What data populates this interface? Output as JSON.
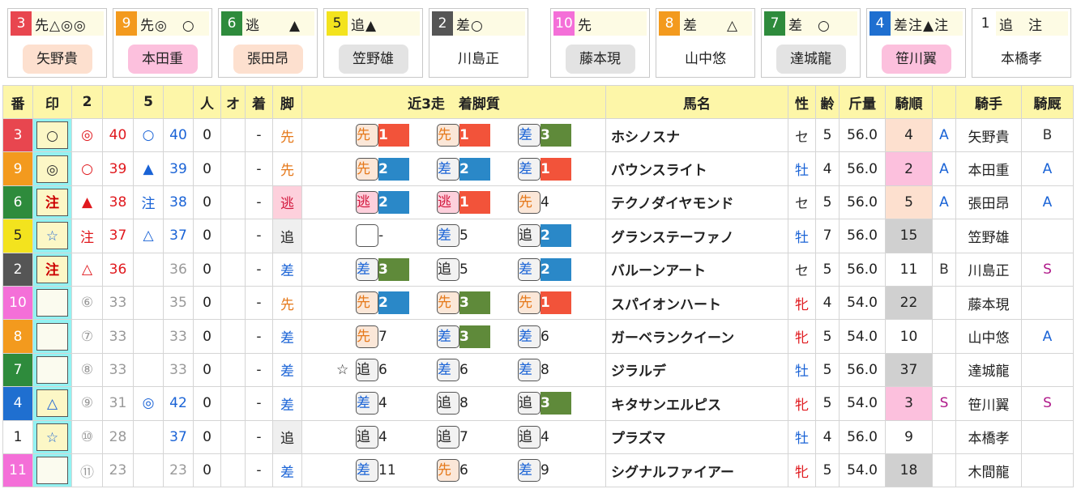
{
  "cards": [
    {
      "num": "3",
      "marks": "先△◎◎",
      "name": "矢野貴",
      "num_color": "#e8464f",
      "name_bg": "#fde0cf"
    },
    {
      "num": "9",
      "marks": "先◎　○",
      "name": "本田重",
      "num_color": "#f39a1e",
      "name_bg": "#fcc0dd"
    },
    {
      "num": "6",
      "marks": "逃　　▲",
      "name": "張田昂",
      "num_color": "#2e8b3c",
      "name_bg": "#fde0cf"
    },
    {
      "num": "5",
      "marks": "追▲",
      "name": "笠野雄",
      "num_color": "#f3e31e",
      "name_bg": "#e3e3e3"
    },
    {
      "num": "2",
      "marks": "差○",
      "name": "川島正",
      "num_color": "#555555",
      "name_bg": "#ffffff"
    },
    {
      "num": "10",
      "marks": "先",
      "name": "藤本現",
      "num_color": "#f46fd8",
      "name_bg": "#e3e3e3"
    },
    {
      "num": "8",
      "marks": "差　　△",
      "name": "山中悠",
      "num_color": "#f39a1e",
      "name_bg": "#ffffff"
    },
    {
      "num": "7",
      "marks": "差　○",
      "name": "達城龍",
      "num_color": "#2e8b3c",
      "name_bg": "#e3e3e3"
    },
    {
      "num": "4",
      "marks": "差注▲注",
      "name": "笹川翼",
      "num_color": "#1f6fd0",
      "name_bg": "#fcc0dd"
    },
    {
      "num": "1",
      "marks": "追　注",
      "name": "本橋孝",
      "num_color": "#ffffff",
      "name_bg": "#ffffff"
    }
  ],
  "headers": [
    "番",
    "印",
    "2",
    "",
    "5",
    "",
    "人",
    "オ",
    "着",
    "脚",
    "近3走　着脚質",
    "馬名",
    "性",
    "齢",
    "斤量",
    "騎順",
    "",
    "騎手",
    "騎厩"
  ],
  "rows": [
    {
      "num": "3",
      "num_color": "#e8464f",
      "mark": "○",
      "m2": "◎",
      "v2": "40",
      "m5": "○",
      "v5": "40",
      "ninki": "0",
      "o": "",
      "chaku": "-",
      "kyaku": "先",
      "runs": [
        {
          "pre": "",
          "leg": "先",
          "rank": "1"
        },
        {
          "pre": "",
          "leg": "先",
          "rank": "1"
        },
        {
          "pre": "",
          "leg": "差",
          "rank": "3"
        }
      ],
      "name": "ホシノスナ",
      "sex": "セ",
      "age": "5",
      "weight": "56.0",
      "jockey_rank": "4",
      "jr_bg": "#fde0cf",
      "grade": "A",
      "jockey": "矢野貴",
      "stable": "B"
    },
    {
      "num": "9",
      "num_color": "#f39a1e",
      "mark": "◎",
      "m2": "○",
      "v2": "39",
      "m5": "▲",
      "v5": "39",
      "ninki": "0",
      "o": "",
      "chaku": "-",
      "kyaku": "先",
      "runs": [
        {
          "pre": "",
          "leg": "先",
          "rank": "2"
        },
        {
          "pre": "",
          "leg": "差",
          "rank": "2"
        },
        {
          "pre": "",
          "leg": "差",
          "rank": "1"
        }
      ],
      "name": "バウンスライト",
      "sex": "牡",
      "age": "4",
      "weight": "56.0",
      "jockey_rank": "2",
      "jr_bg": "#fcc0dd",
      "grade": "A",
      "jockey": "本田重",
      "stable": "A"
    },
    {
      "num": "6",
      "num_color": "#2e8b3c",
      "mark": "注",
      "m2": "▲",
      "v2": "38",
      "m5": "注",
      "v5": "38",
      "ninki": "0",
      "o": "",
      "chaku": "-",
      "kyaku": "逃",
      "runs": [
        {
          "pre": "",
          "leg": "逃",
          "rank": "2"
        },
        {
          "pre": "",
          "leg": "逃",
          "rank": "1"
        },
        {
          "pre": "",
          "leg": "先",
          "rank": "4"
        }
      ],
      "name": "テクノダイヤモンド",
      "sex": "セ",
      "age": "5",
      "weight": "56.0",
      "jockey_rank": "5",
      "jr_bg": "#fde0cf",
      "grade": "A",
      "jockey": "張田昂",
      "stable": "A"
    },
    {
      "num": "5",
      "num_color": "#f3e31e",
      "mark": "☆",
      "m2": "注",
      "v2": "37",
      "m5": "△",
      "v5": "37",
      "ninki": "0",
      "o": "",
      "chaku": "-",
      "kyaku": "追",
      "runs": [
        {
          "pre": "",
          "leg": "",
          "rank": "-"
        },
        {
          "pre": "",
          "leg": "差",
          "rank": "5"
        },
        {
          "pre": "",
          "leg": "追",
          "rank": "2"
        }
      ],
      "name": "グランステーファノ",
      "sex": "牡",
      "age": "7",
      "weight": "56.0",
      "jockey_rank": "15",
      "jr_bg": "#d0d0d0",
      "grade": "",
      "jockey": "笠野雄",
      "stable": ""
    },
    {
      "num": "2",
      "num_color": "#555555",
      "mark": "注",
      "m2": "△",
      "v2": "36",
      "m5": "",
      "v5": "36",
      "ninki": "0",
      "o": "",
      "chaku": "-",
      "kyaku": "差",
      "runs": [
        {
          "pre": "",
          "leg": "差",
          "rank": "3"
        },
        {
          "pre": "",
          "leg": "追",
          "rank": "5"
        },
        {
          "pre": "",
          "leg": "差",
          "rank": "2"
        }
      ],
      "name": "バルーンアート",
      "sex": "セ",
      "age": "5",
      "weight": "56.0",
      "jockey_rank": "11",
      "jr_bg": "#ffffff",
      "grade": "B",
      "jockey": "川島正",
      "stable": "S"
    },
    {
      "num": "10",
      "num_color": "#f46fd8",
      "mark": "",
      "m2": "⑥",
      "v2": "33",
      "m5": "",
      "v5": "35",
      "ninki": "0",
      "o": "",
      "chaku": "-",
      "kyaku": "先",
      "runs": [
        {
          "pre": "",
          "leg": "先",
          "rank": "2"
        },
        {
          "pre": "",
          "leg": "先",
          "rank": "3"
        },
        {
          "pre": "",
          "leg": "先",
          "rank": "1"
        }
      ],
      "name": "スパイオンハート",
      "sex": "牝",
      "age": "4",
      "weight": "54.0",
      "jockey_rank": "22",
      "jr_bg": "#d0d0d0",
      "grade": "",
      "jockey": "藤本現",
      "stable": ""
    },
    {
      "num": "8",
      "num_color": "#f39a1e",
      "mark": "",
      "m2": "⑦",
      "v2": "33",
      "m5": "",
      "v5": "33",
      "ninki": "0",
      "o": "",
      "chaku": "-",
      "kyaku": "差",
      "runs": [
        {
          "pre": "",
          "leg": "先",
          "rank": "7"
        },
        {
          "pre": "",
          "leg": "差",
          "rank": "3"
        },
        {
          "pre": "",
          "leg": "差",
          "rank": "6"
        }
      ],
      "name": "ガーベランクイーン",
      "sex": "牝",
      "age": "5",
      "weight": "54.0",
      "jockey_rank": "10",
      "jr_bg": "#ffffff",
      "grade": "",
      "jockey": "山中悠",
      "stable": "A"
    },
    {
      "num": "7",
      "num_color": "#2e8b3c",
      "mark": "",
      "m2": "⑧",
      "v2": "33",
      "m5": "",
      "v5": "33",
      "ninki": "0",
      "o": "",
      "chaku": "-",
      "kyaku": "差",
      "runs": [
        {
          "pre": "☆",
          "leg": "追",
          "rank": "6"
        },
        {
          "pre": "",
          "leg": "差",
          "rank": "6"
        },
        {
          "pre": "",
          "leg": "差",
          "rank": "8"
        }
      ],
      "name": "ジラルデ",
      "sex": "牡",
      "age": "5",
      "weight": "56.0",
      "jockey_rank": "37",
      "jr_bg": "#d0d0d0",
      "grade": "",
      "jockey": "達城龍",
      "stable": ""
    },
    {
      "num": "4",
      "num_color": "#1f6fd0",
      "mark": "△",
      "m2": "⑨",
      "v2": "31",
      "m5": "◎",
      "v5": "42",
      "ninki": "0",
      "o": "",
      "chaku": "-",
      "kyaku": "差",
      "runs": [
        {
          "pre": "",
          "leg": "差",
          "rank": "4"
        },
        {
          "pre": "",
          "leg": "追",
          "rank": "8"
        },
        {
          "pre": "",
          "leg": "追",
          "rank": "3"
        }
      ],
      "name": "キタサンエルピス",
      "sex": "牝",
      "age": "5",
      "weight": "54.0",
      "jockey_rank": "3",
      "jr_bg": "#fcc0dd",
      "grade": "S",
      "jockey": "笹川翼",
      "stable": "S"
    },
    {
      "num": "1",
      "num_color": "#ffffff",
      "mark": "☆",
      "m2": "⑩",
      "v2": "28",
      "m5": "",
      "v5": "37",
      "ninki": "0",
      "o": "",
      "chaku": "-",
      "kyaku": "追",
      "runs": [
        {
          "pre": "",
          "leg": "追",
          "rank": "4"
        },
        {
          "pre": "",
          "leg": "追",
          "rank": "7"
        },
        {
          "pre": "",
          "leg": "追",
          "rank": "4"
        }
      ],
      "name": "プラズマ",
      "sex": "牡",
      "age": "4",
      "weight": "56.0",
      "jockey_rank": "9",
      "jr_bg": "#ffffff",
      "grade": "",
      "jockey": "本橋孝",
      "stable": ""
    },
    {
      "num": "11",
      "num_color": "#f46fd8",
      "mark": "",
      "m2": "⑪",
      "v2": "23",
      "m5": "",
      "v5": "23",
      "ninki": "0",
      "o": "",
      "chaku": "-",
      "kyaku": "差",
      "runs": [
        {
          "pre": "",
          "leg": "差",
          "rank": "11"
        },
        {
          "pre": "",
          "leg": "先",
          "rank": "6"
        },
        {
          "pre": "",
          "leg": "差",
          "rank": "9"
        }
      ],
      "name": "シグナルファイアー",
      "sex": "牝",
      "age": "5",
      "weight": "54.0",
      "jockey_rank": "18",
      "jr_bg": "#d0d0d0",
      "grade": "",
      "jockey": "木間龍",
      "stable": ""
    }
  ]
}
